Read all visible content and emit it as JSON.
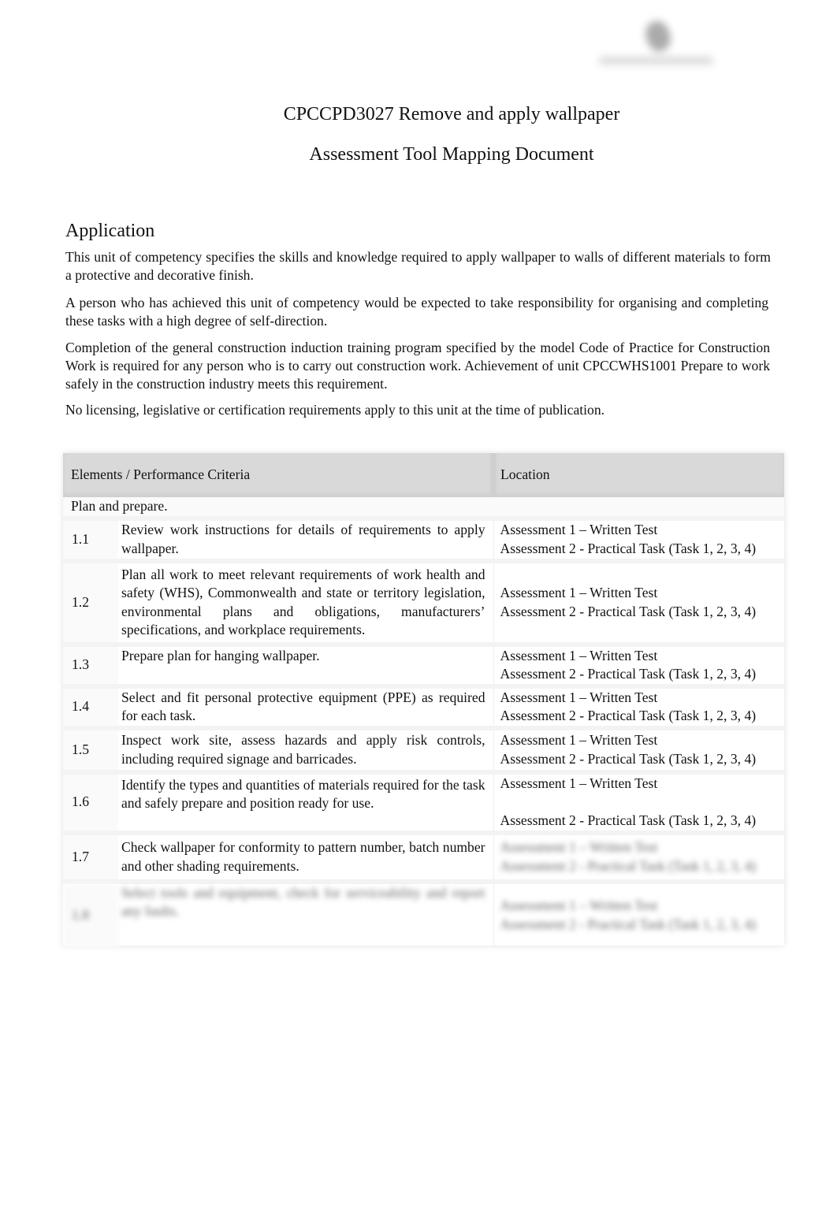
{
  "header": {
    "logo_icon": "organisation-logo-icon",
    "title": "CPCCPD3027 Remove and apply wallpaper",
    "subtitle": "Assessment Tool Mapping Document"
  },
  "application": {
    "heading": "Application",
    "paragraphs": [
      "This unit of competency specifies the skills and knowledge required to apply wallpaper to walls of different materials to form a protective and decorative finish.",
      "A person who has achieved this unit of competency would be expected to take responsibility for organising and completing these tasks with a high degree of self-direction.",
      "Completion of the general construction induction training program specified by the model Code of Practice for Construction Work is required for any person who is to carry out construction work. Achievement of unit CPCCWHS1001 Prepare to work safely in the construction industry meets this requirement.",
      "No licensing, legislative or certification requirements apply to this unit at the time of publication."
    ]
  },
  "mapping_table": {
    "headers": [
      "Elements / Performance Criteria",
      "Location"
    ],
    "section": "Plan and prepare.",
    "rows": [
      {
        "num": "1.1",
        "desc": "Review work instructions for details of requirements to apply wallpaper.",
        "loc1": "Assessment 1 – Written Test",
        "loc2": "Assessment 2 - Practical Task (Task 1, 2, 3, 4)"
      },
      {
        "num": "1.2",
        "desc": "Plan all work to meet relevant requirements of work health and safety (WHS), Commonwealth and state or territory legislation, environmental plans and obligations, manufacturers’ specifications, and workplace requirements.",
        "loc1": "Assessment 1 – Written Test",
        "loc2": "Assessment 2 - Practical Task (Task 1, 2, 3, 4)"
      },
      {
        "num": "1.3",
        "desc": "Prepare plan for hanging wallpaper.",
        "loc1": "Assessment 1 – Written Test",
        "loc2": "Assessment 2 - Practical Task (Task 1, 2, 3, 4)"
      },
      {
        "num": "1.4",
        "desc": "Select and fit personal protective equipment (PPE) as required for each task.",
        "loc1": "Assessment 1 – Written Test",
        "loc2": "Assessment 2 - Practical Task (Task 1, 2, 3, 4)"
      },
      {
        "num": "1.5",
        "desc": "Inspect work site, assess hazards and apply risk controls, including required signage and barricades.",
        "loc1": "Assessment 1 – Written Test",
        "loc2": "Assessment 2 - Practical Task (Task 1, 2, 3, 4)"
      },
      {
        "num": "1.6",
        "desc": "Identify the types and quantities of materials required for the task and safely prepare and position ready for use.",
        "loc1": "Assessment 1 – Written Test",
        "loc2": "Assessment 2 - Practical Task (Task 1, 2, 3, 4)"
      },
      {
        "num": "1.7",
        "desc": "Check wallpaper for conformity to pattern number, batch number and other shading requirements.",
        "loc1": "Assessment 1 – Written Test",
        "loc2": "Assessment 2 - Practical Task (Task 1, 2, 3, 4)"
      },
      {
        "num": "1.8",
        "desc": "Select tools and equipment, check for serviceability and report any faults.",
        "loc1": "Assessment 1 – Written Test",
        "loc2": "Assessment 2 - Practical Task (Task 1, 2, 3, 4)"
      }
    ]
  }
}
